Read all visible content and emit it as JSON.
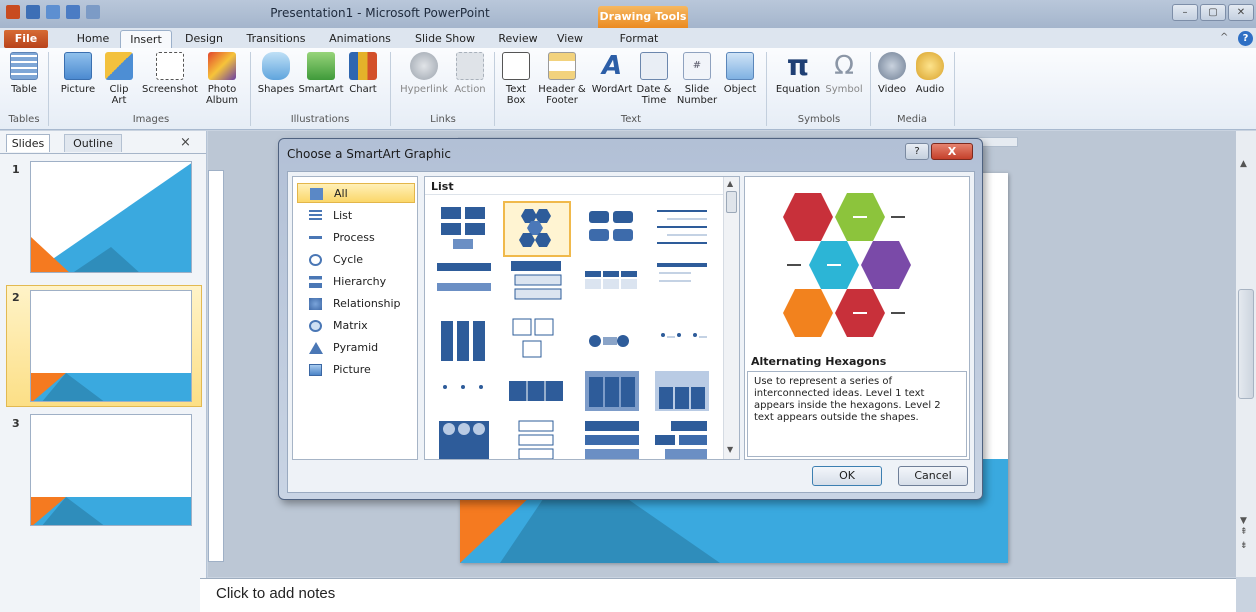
{
  "window": {
    "title": "Presentation1 - Microsoft PowerPoint",
    "context_tab": "Drawing Tools"
  },
  "tabs": [
    "Home",
    "Insert",
    "Design",
    "Transitions",
    "Animations",
    "Slide Show",
    "Review",
    "View",
    "Format"
  ],
  "file_tab": "File",
  "ribbon": {
    "table": "Table",
    "picture": "Picture",
    "clip_art": "Clip Art",
    "screenshot": "Screenshot",
    "photo_album": "Photo Album",
    "shapes": "Shapes",
    "smartart": "SmartArt",
    "chart": "Chart",
    "hyperlink": "Hyperlink",
    "action": "Action",
    "text_box": "Text Box",
    "header_footer": "Header & Footer",
    "wordart": "WordArt",
    "date_time": "Date & Time",
    "slide_number": "Slide Number",
    "object": "Object",
    "equation": "Equation",
    "symbol": "Symbol",
    "video": "Video",
    "audio": "Audio",
    "groups": {
      "tables": "Tables",
      "images": "Images",
      "illustrations": "Illustrations",
      "links": "Links",
      "text": "Text",
      "symbols": "Symbols",
      "media": "Media"
    }
  },
  "panel": {
    "tab_slides": "Slides",
    "tab_outline": "Outline",
    "close": "×",
    "slides": [
      "1",
      "2",
      "3"
    ]
  },
  "notes": {
    "placeholder": "Click to add notes"
  },
  "dialog": {
    "title": "Choose a SmartArt Graphic",
    "help": "?",
    "close": "X",
    "categories": [
      "All",
      "List",
      "Process",
      "Cycle",
      "Hierarchy",
      "Relationship",
      "Matrix",
      "Pyramid",
      "Picture"
    ],
    "selected_category": "All",
    "gallery_header": "List",
    "preview_title": "Alternating Hexagons",
    "preview_desc": "Use to represent a series of interconnected ideas. Level 1 text appears inside the hexagons. Level 2 text appears outside the shapes.",
    "ok": "OK",
    "cancel": "Cancel"
  },
  "colors": {
    "accent_blue": "#2e5c9a",
    "slide_cyan": "#3aa9df",
    "slide_orange": "#f57a20",
    "file_tab": "#c25426",
    "drawing_tools": "#f0a040"
  }
}
